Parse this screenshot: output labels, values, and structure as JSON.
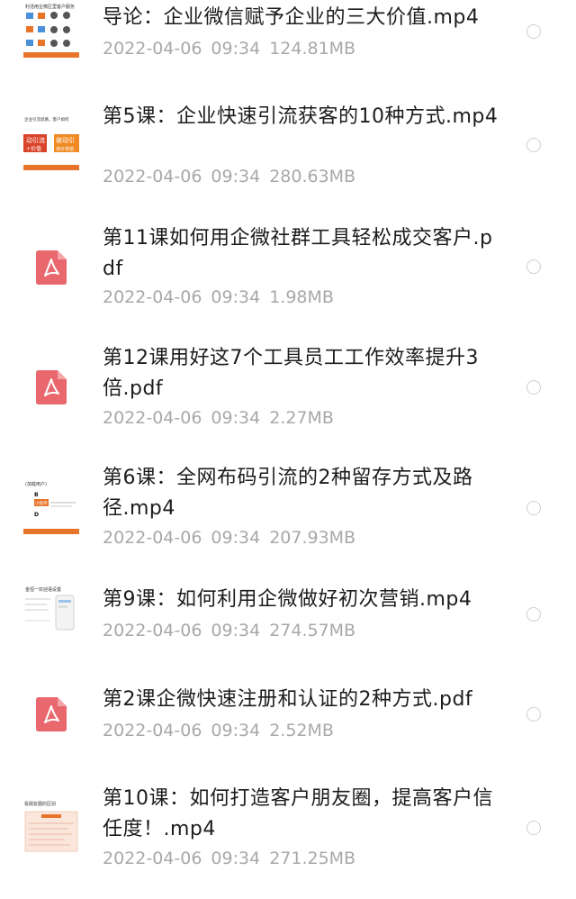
{
  "files": [
    {
      "name": "导论：企业微信赋予企业的三大价值.mp4",
      "date": "2022-04-06",
      "time": "09:34",
      "size": "124.81MB",
      "type": "video",
      "thumb_text": [
        "利活用企微区里客户服务"
      ]
    },
    {
      "name": "第5课：企业快速引流获客的10种方式.mp4",
      "date": "2022-04-06",
      "time": "09:34",
      "size": "280.63MB",
      "type": "video",
      "thumb_text": [
        "企业引流思路，客户如何",
        "动引流",
        "被动引",
        "+价值",
        "涨价增值"
      ]
    },
    {
      "name": "第11课如何用企微社群工具轻松成交客户.pdf",
      "date": "2022-04-06",
      "time": "09:34",
      "size": "1.98MB",
      "type": "pdf"
    },
    {
      "name": "第12课用好这7个工具员工工作效率提升3倍.pdf",
      "date": "2022-04-06",
      "time": "09:34",
      "size": "2.27MB",
      "type": "pdf"
    },
    {
      "name": "第6课：全网布码引流的2种留存方式及路径.mp4",
      "date": "2022-04-06",
      "time": "09:34",
      "size": "207.93MB",
      "type": "video",
      "thumb_text": [
        "(加载用户)",
        "B",
        "小程序",
        "D"
      ]
    },
    {
      "name": "第9课：如何利用企微做好初次营销.mp4",
      "date": "2022-04-06",
      "time": "09:34",
      "size": "274.57MB",
      "type": "video",
      "thumb_text": [
        "金恒一欢迎语设置"
      ]
    },
    {
      "name": "第2课企微快速注册和认证的2种方式.pdf",
      "date": "2022-04-06",
      "time": "09:34",
      "size": "2.52MB",
      "type": "pdf"
    },
    {
      "name": "第10课：如何打造客户朋友圈，提高客户信任度！.mp4",
      "date": "2022-04-06",
      "time": "09:34",
      "size": "271.25MB",
      "type": "video",
      "thumb_text": [
        "看朋友圈的区别"
      ]
    }
  ],
  "colors": {
    "pdf_icon": "#e9686e",
    "meta_text": "#a8a8a8",
    "radio_border": "#cfcfcf",
    "thumb_accent": "#e8742a"
  }
}
